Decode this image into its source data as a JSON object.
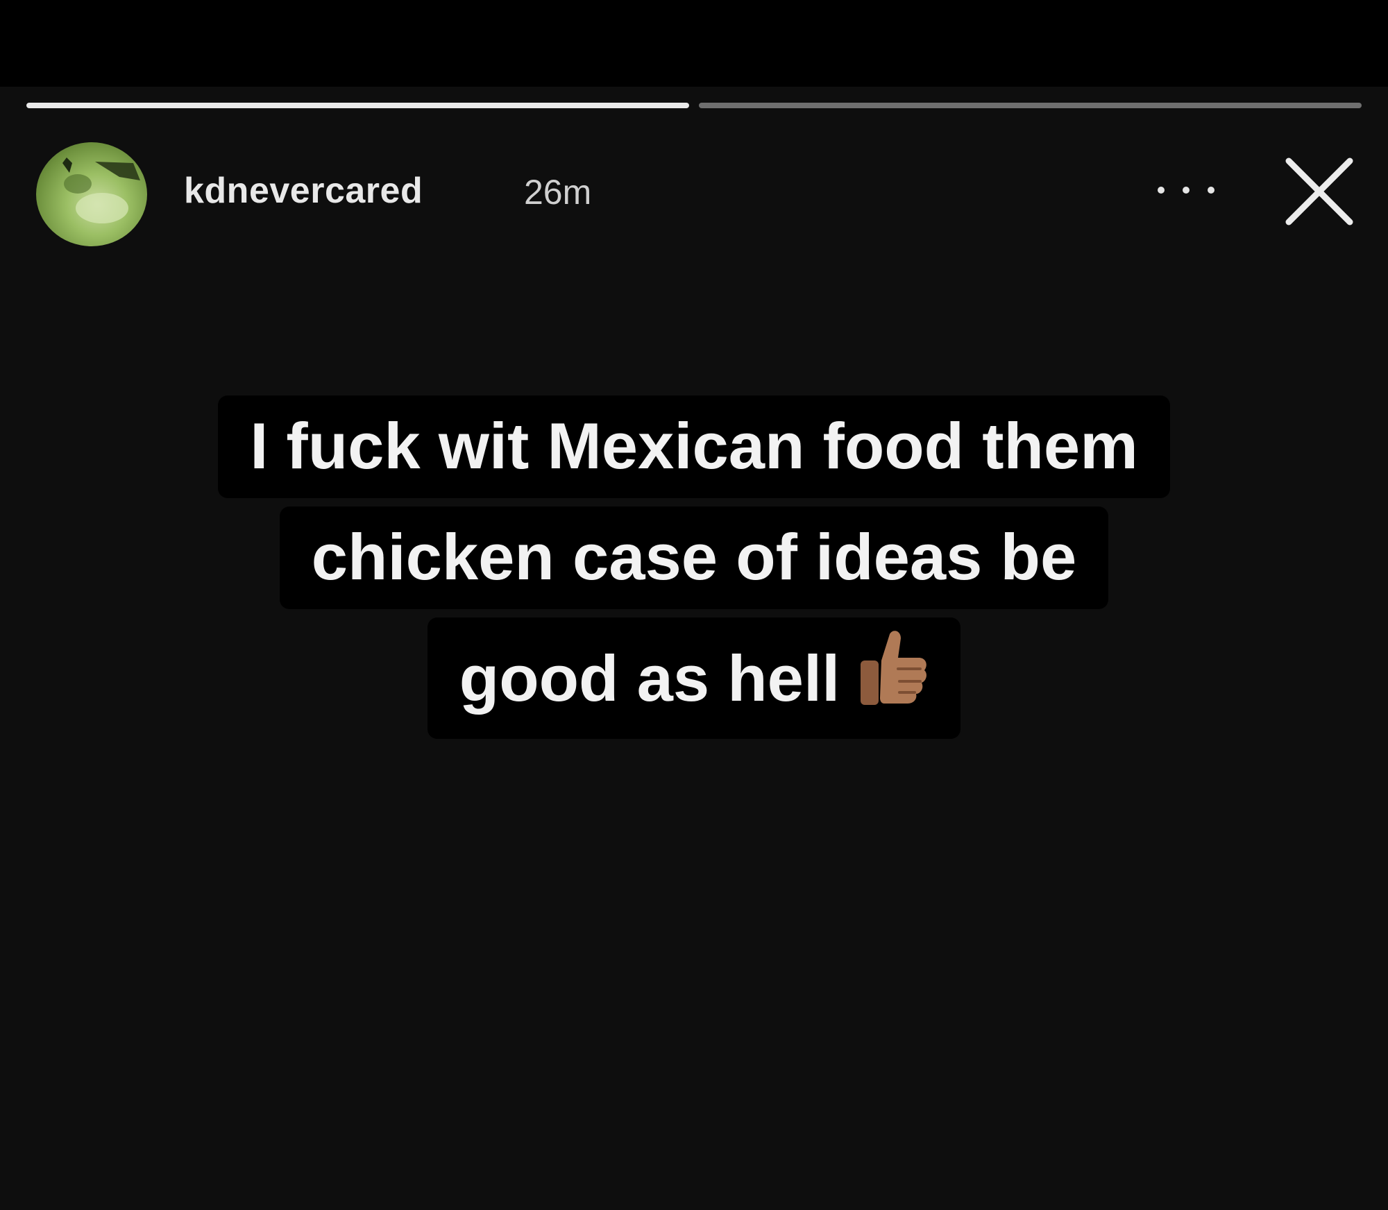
{
  "story": {
    "progress": [
      1.0,
      0.0
    ],
    "header": {
      "username": "kdnevercared",
      "time_ago": "26m"
    },
    "caption": {
      "lines": [
        "I fuck wit Mexican food them",
        "chicken case of ideas be",
        "good as hell"
      ],
      "trailing_emoji": "thumbs-up-icon"
    },
    "colors": {
      "background": "#0e0e0e",
      "text": "#f2f2f2",
      "caption_bg": "#000000",
      "progress_active": "#e9e9e9",
      "progress_inactive": "#6f6f6f",
      "avatar": "#9bbf64"
    }
  }
}
